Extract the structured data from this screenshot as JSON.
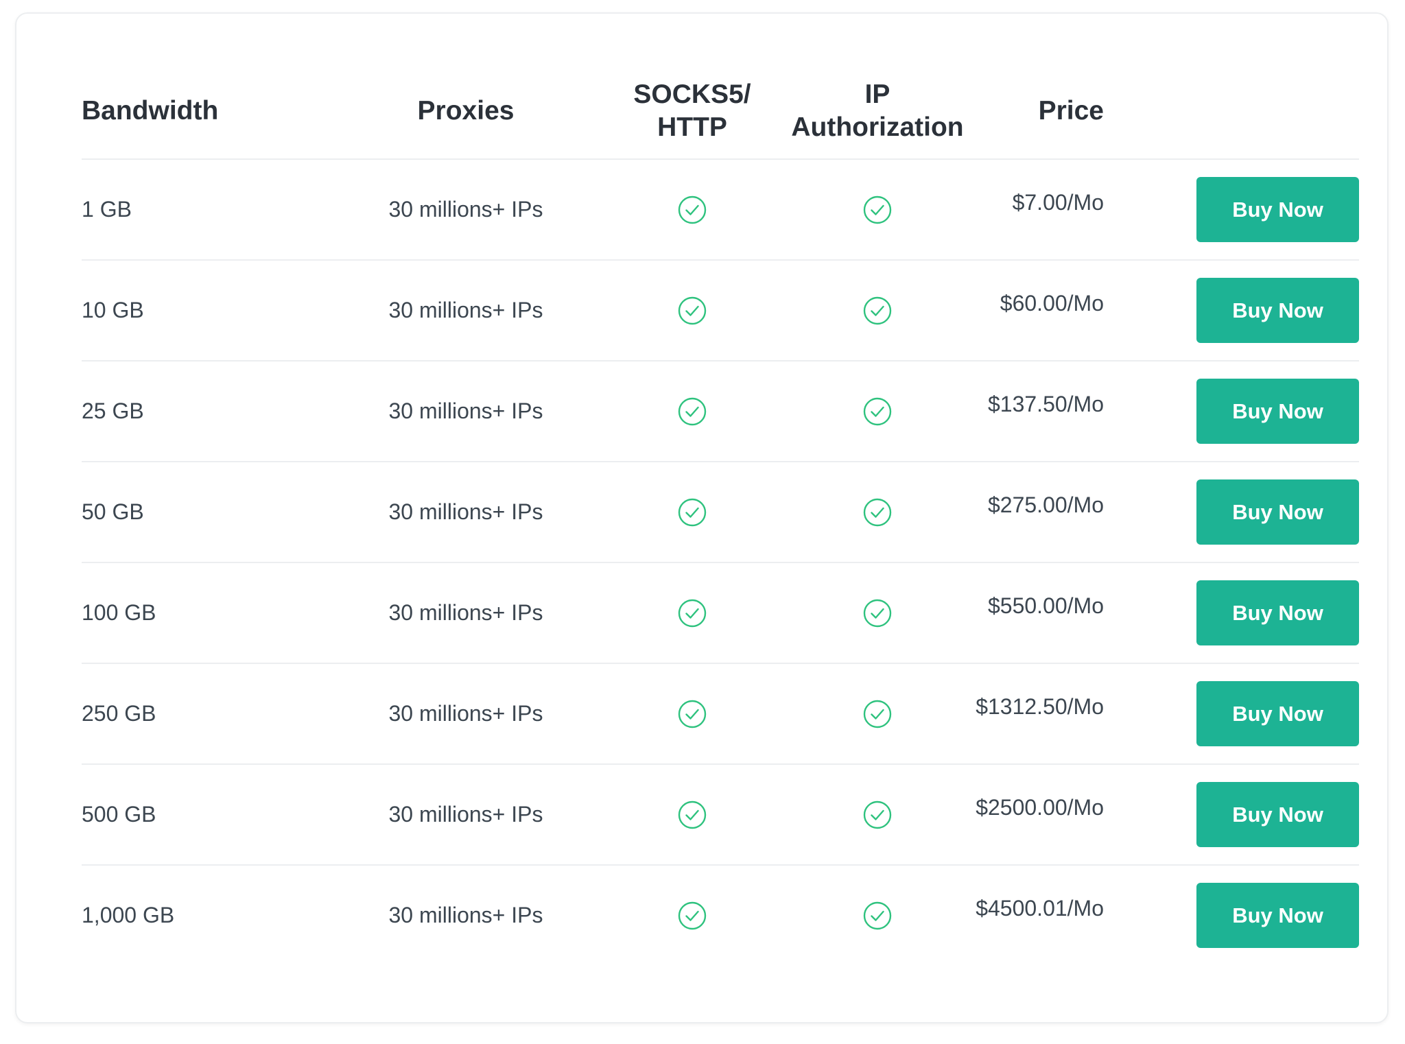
{
  "headers": {
    "bandwidth": "Bandwidth",
    "proxies": "Proxies",
    "socks_line1": "SOCKS5/",
    "socks_line2": "HTTP",
    "ip_line1": "IP",
    "ip_line2": "Authorization",
    "price": "Price"
  },
  "colors": {
    "accent": "#1db394",
    "check": "#2ec27e",
    "text": "#3c4650",
    "heading": "#2b3139"
  },
  "icons": {
    "feature_included": "check-circle-icon"
  },
  "plans": [
    {
      "bandwidth": "1 GB",
      "proxies": "30 millions+ IPs",
      "socks5_http": true,
      "ip_authorization": true,
      "price": "$7.00/Mo",
      "button": "Buy Now"
    },
    {
      "bandwidth": "10 GB",
      "proxies": "30 millions+ IPs",
      "socks5_http": true,
      "ip_authorization": true,
      "price": "$60.00/Mo",
      "button": "Buy Now"
    },
    {
      "bandwidth": "25 GB",
      "proxies": "30 millions+ IPs",
      "socks5_http": true,
      "ip_authorization": true,
      "price": "$137.50/Mo",
      "button": "Buy Now"
    },
    {
      "bandwidth": "50 GB",
      "proxies": "30 millions+ IPs",
      "socks5_http": true,
      "ip_authorization": true,
      "price": "$275.00/Mo",
      "button": "Buy Now"
    },
    {
      "bandwidth": "100 GB",
      "proxies": "30 millions+ IPs",
      "socks5_http": true,
      "ip_authorization": true,
      "price": "$550.00/Mo",
      "button": "Buy Now"
    },
    {
      "bandwidth": "250 GB",
      "proxies": "30 millions+ IPs",
      "socks5_http": true,
      "ip_authorization": true,
      "price": "$1312.50/Mo",
      "button": "Buy Now"
    },
    {
      "bandwidth": "500 GB",
      "proxies": "30 millions+ IPs",
      "socks5_http": true,
      "ip_authorization": true,
      "price": "$2500.00/Mo",
      "button": "Buy Now"
    },
    {
      "bandwidth": "1,000 GB",
      "proxies": "30 millions+ IPs",
      "socks5_http": true,
      "ip_authorization": true,
      "price": "$4500.01/Mo",
      "button": "Buy Now"
    }
  ]
}
